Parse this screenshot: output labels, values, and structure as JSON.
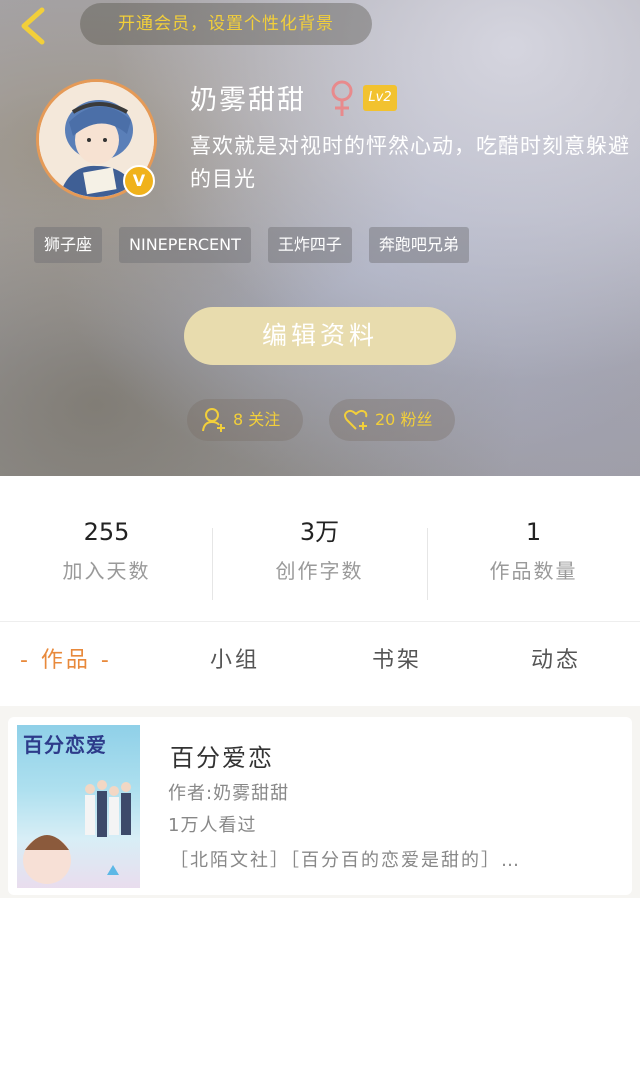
{
  "header": {
    "vip_prompt": "开通会员，设置个性化背景",
    "username": "奶雾甜甜",
    "level": "Lv2",
    "vip_badge": "V",
    "bio": "喜欢就是对视时的怦然心动，吃醋时刻意躲避的目光",
    "tags": [
      "狮子座",
      "NINEPERCENT",
      "王炸四子",
      "奔跑吧兄弟"
    ],
    "edit_button": "编辑资料",
    "follow_label": "8 关注",
    "fans_label": "20 粉丝"
  },
  "stats": [
    {
      "value": "255",
      "label": "加入天数"
    },
    {
      "value": "3万",
      "label": "创作字数"
    },
    {
      "value": "1",
      "label": "作品数量"
    }
  ],
  "tabs": [
    {
      "label": "- 作品 -",
      "active": true
    },
    {
      "label": "小组",
      "active": false
    },
    {
      "label": "书架",
      "active": false
    },
    {
      "label": "动态",
      "active": false
    }
  ],
  "works": [
    {
      "cover_title": "百分恋爱",
      "title": "百分爱恋",
      "author": "作者:奶雾甜甜",
      "views": "1万人看过",
      "tags": "［北陌文社］［百分百的恋爱是甜的］…"
    }
  ],
  "colors": {
    "accent": "#e8893b",
    "gold": "#f2cf3a",
    "edit_button": "#e8dcae",
    "gender": "#e88a8c"
  }
}
